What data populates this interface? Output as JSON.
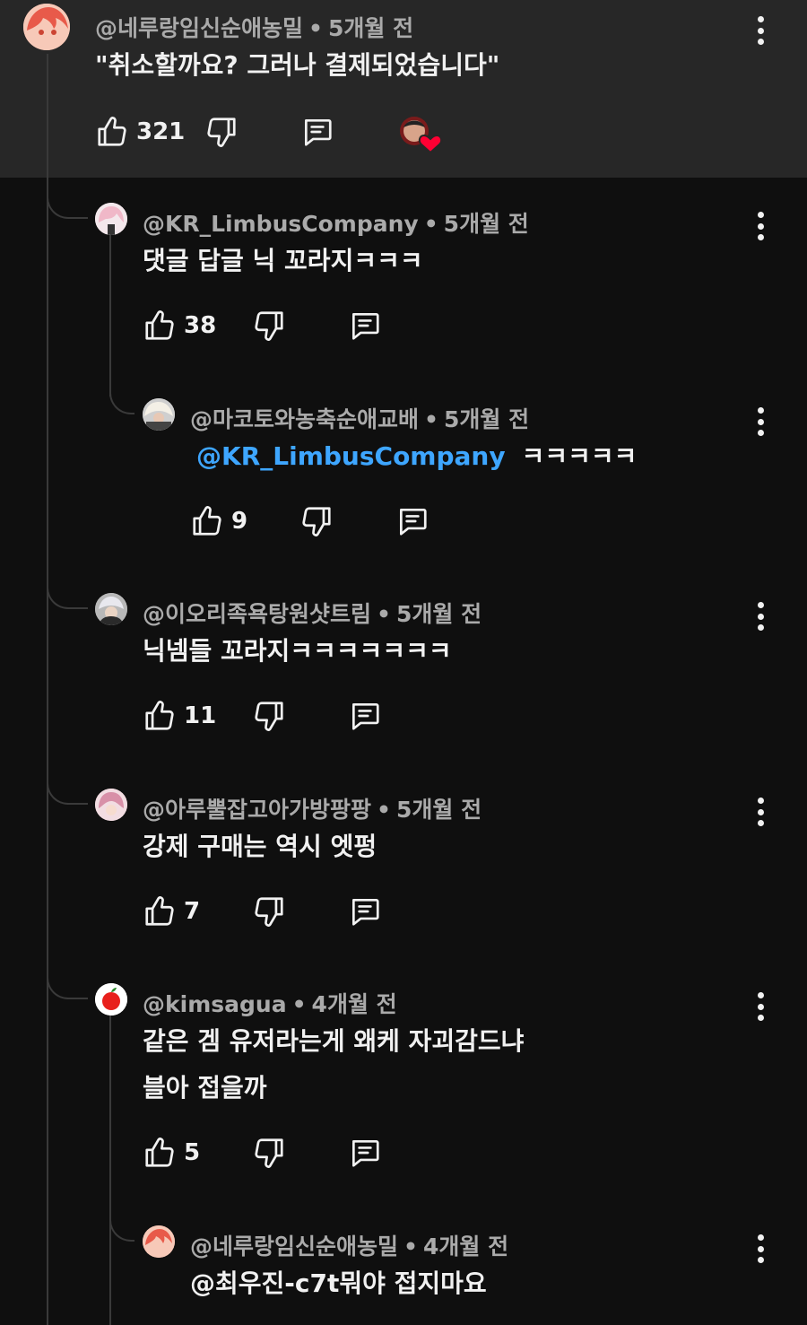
{
  "comments": [
    {
      "handle": "@네루랑임신순애농밀",
      "time": "5개월 전",
      "lines": [
        "\"취소할까요? 그러나 결제되었습니다\""
      ],
      "likes": "321"
    },
    {
      "handle": "@KR_LimbusCompany",
      "time": "5개월 전",
      "lines": [
        "댓글 답글 닉 꼬라지ㅋㅋㅋ"
      ],
      "likes": "38"
    },
    {
      "handle": "@마코토와농축순애교배",
      "time": "5개월 전",
      "mention": "@KR_LimbusCompany",
      "text": "ㅋㅋㅋㅋㅋ",
      "likes": "9"
    },
    {
      "handle": "@이오리족욕탕원샷트림",
      "time": "5개월 전",
      "lines": [
        "닉넴들 꼬라지ㅋㅋㅋㅋㅋㅋㅋ"
      ],
      "likes": "11"
    },
    {
      "handle": "@아루뿔잡고아가방팡팡",
      "time": "5개월 전",
      "lines": [
        "강제 구매는 역시 엣펑"
      ],
      "likes": "7"
    },
    {
      "handle": "@kimsagua",
      "time": "4개월 전",
      "lines": [
        "같은 겜 유저라는게 왜케 자괴감드냐",
        "블아 접을까"
      ],
      "likes": "5"
    },
    {
      "handle": "@네루랑임신순애농밀",
      "time": "4개월 전",
      "lines": [
        "@최우진-c7t뭐야 접지마요"
      ]
    }
  ],
  "separator": "•",
  "icons": {
    "like": "thumbs-up-icon",
    "dislike": "thumbs-down-icon",
    "reply": "reply-icon",
    "more": "more-vert-icon",
    "heart": "creator-heart-icon"
  },
  "colors": {
    "background": "#0f0f0f",
    "highlight": "#272727",
    "mention": "#3ea6ff",
    "heart": "#ff0033"
  }
}
